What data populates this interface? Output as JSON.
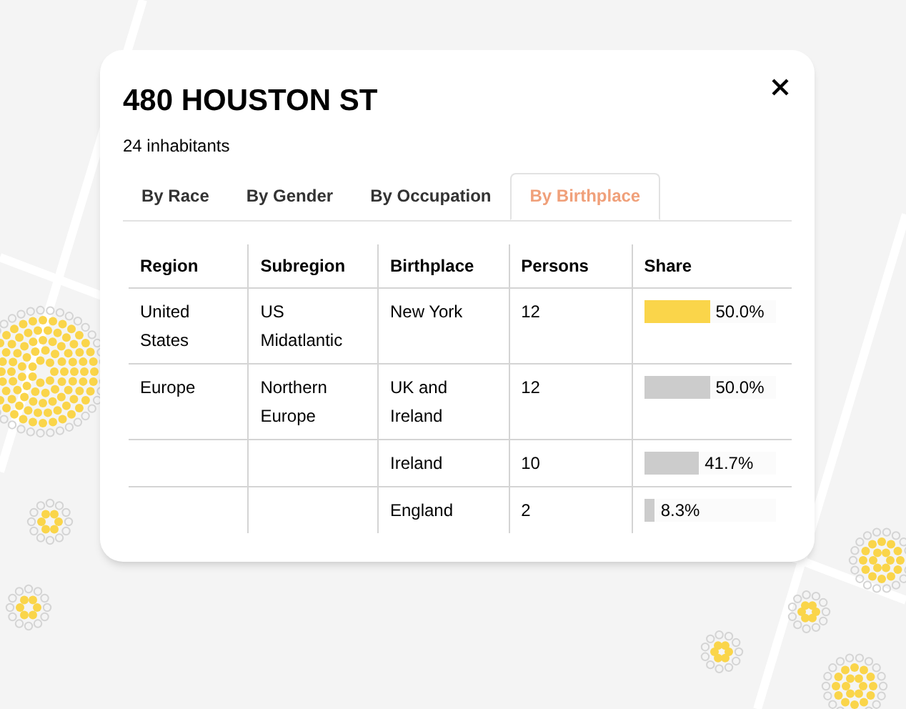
{
  "popup": {
    "title": "480 HOUSTON ST",
    "subtitle": "24 inhabitants"
  },
  "tabs": [
    {
      "label": "By Race",
      "selected": false
    },
    {
      "label": "By Gender",
      "selected": false
    },
    {
      "label": "By Occupation",
      "selected": false
    },
    {
      "label": "By Birthplace",
      "selected": true
    }
  ],
  "table": {
    "columns": [
      "Region",
      "Subregion",
      "Birthplace",
      "Persons",
      "Share"
    ],
    "rows": [
      {
        "region": "United States",
        "subregion": "US Midatlantic",
        "birthplace": "New York",
        "persons": "12",
        "level": 0.5,
        "share": "50.0%",
        "color": "#fad54a"
      },
      {
        "region": "Europe",
        "subregion": "Northern Europe",
        "birthplace": "UK and Ireland",
        "persons": "12",
        "level": 0.5,
        "share": "50.0%",
        "color": "#cccccc"
      },
      {
        "birthplace": "Ireland",
        "persons": "10",
        "level": 0.417,
        "share": "41.7%",
        "color": "#cccccc"
      },
      {
        "birthplace": "England",
        "persons": "2",
        "level": 0.083,
        "share": "8.3%",
        "color": "#cccccc"
      }
    ]
  }
}
